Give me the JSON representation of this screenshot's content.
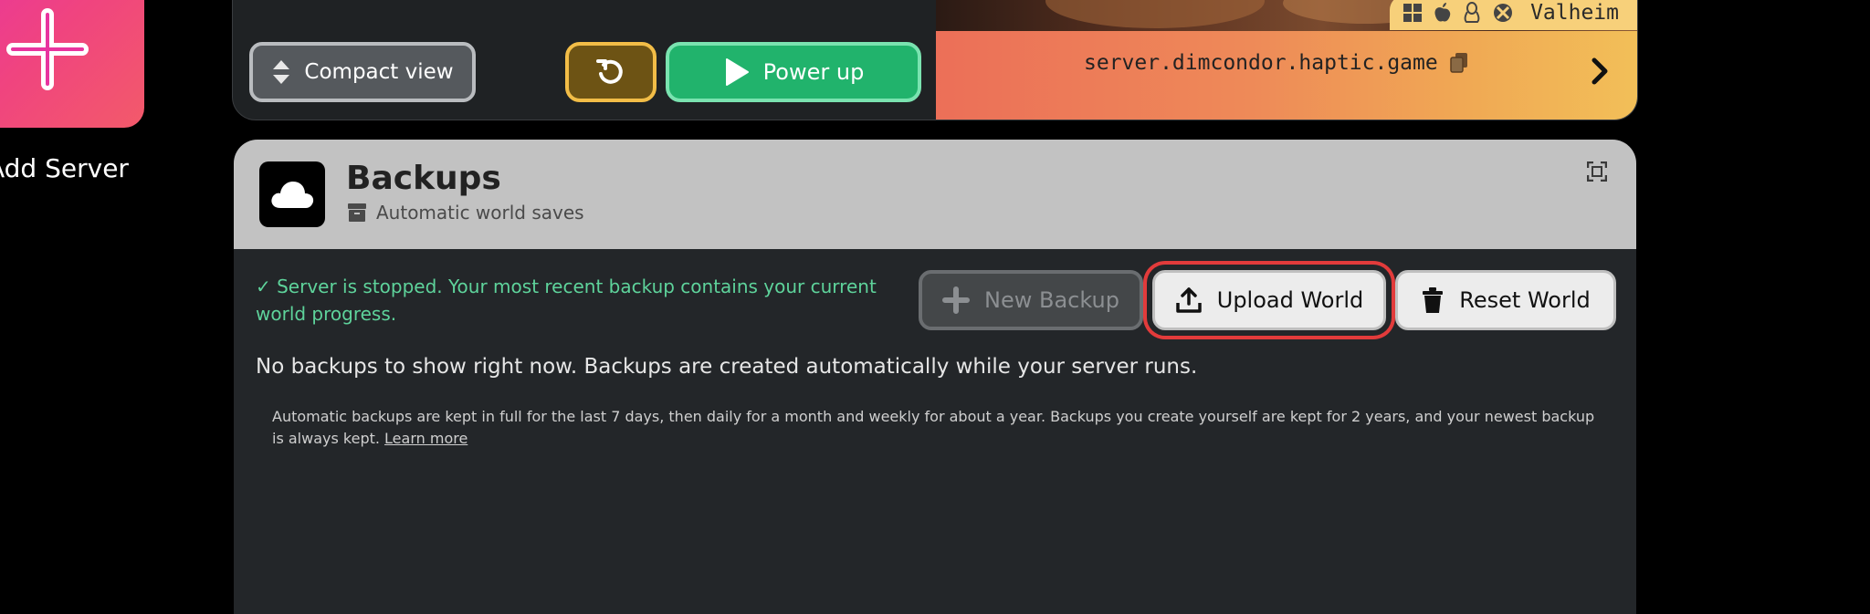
{
  "sidebar": {
    "add_server_label": "Add Server"
  },
  "server_card": {
    "compact_view_label": "Compact view",
    "power_label": "Power up",
    "game_name": "Valheim",
    "platforms": [
      "windows-icon",
      "apple-icon",
      "linux-icon",
      "xbox-icon"
    ],
    "address": "server.dimcondor.haptic.game"
  },
  "backups": {
    "title": "Backups",
    "subtitle": "Automatic world saves",
    "status": "✓ Server is stopped. Your most recent backup contains your current world progress.",
    "new_backup_label": "New Backup",
    "upload_world_label": "Upload World",
    "reset_world_label": "Reset World",
    "empty_message": "No backups to show right now. Backups are created automatically while your server runs.",
    "retention_note": "Automatic backups are kept in full for the last 7 days, then daily for a month and weekly for about a year. Backups you create yourself are kept for 2 years, and your newest backup is always kept.",
    "learn_more_label": "Learn more"
  },
  "colors": {
    "power_green": "#21b36c",
    "restart_gold": "#f2bd47",
    "status_green": "#5ed39b",
    "highlight_red": "#e23b3b"
  }
}
